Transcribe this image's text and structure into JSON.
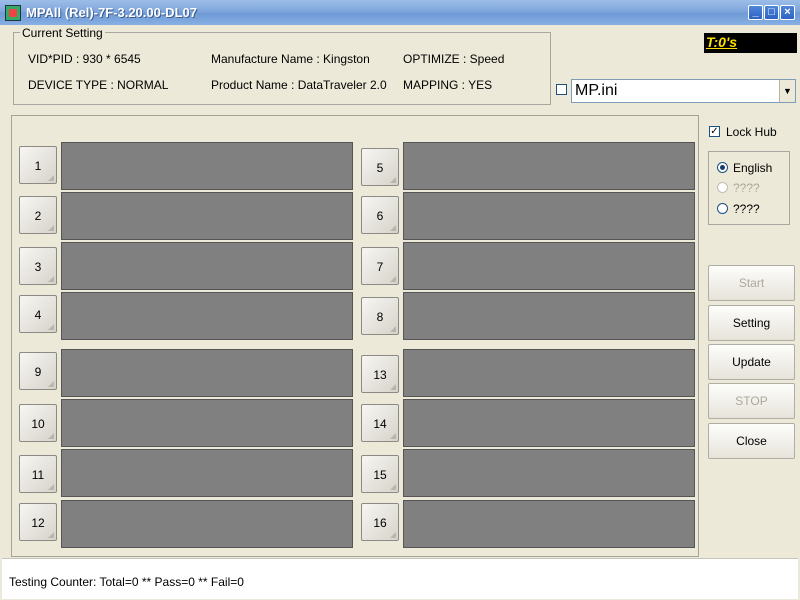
{
  "window": {
    "title": "MPAll (Rel)-7F-3.20.00-DL07"
  },
  "current_setting": {
    "legend": "Current Setting",
    "vid_pid": "VID*PID :  930 * 6545",
    "device_type": "DEVICE TYPE : NORMAL",
    "manufacture_name": "Manufacture Name : Kingston",
    "product_name": "Product Name : DataTraveler 2.0",
    "optimize": "OPTIMIZE : Speed",
    "mapping": "MAPPING : YES"
  },
  "timer": "T:0's",
  "ini_combo": {
    "checked": false,
    "value": "MP.ini"
  },
  "lock_hub": {
    "label": "Lock Hub",
    "checked": true
  },
  "language": {
    "options": [
      "English",
      "????",
      "????"
    ],
    "selected": 0
  },
  "slots": [
    "1",
    "2",
    "3",
    "4",
    "5",
    "6",
    "7",
    "8",
    "9",
    "10",
    "11",
    "12",
    "13",
    "14",
    "15",
    "16"
  ],
  "buttons": {
    "start": "Start",
    "setting": "Setting",
    "update": "Update",
    "stop": "STOP",
    "close": "Close"
  },
  "status": "Testing Counter: Total=0 ** Pass=0 ** Fail=0"
}
